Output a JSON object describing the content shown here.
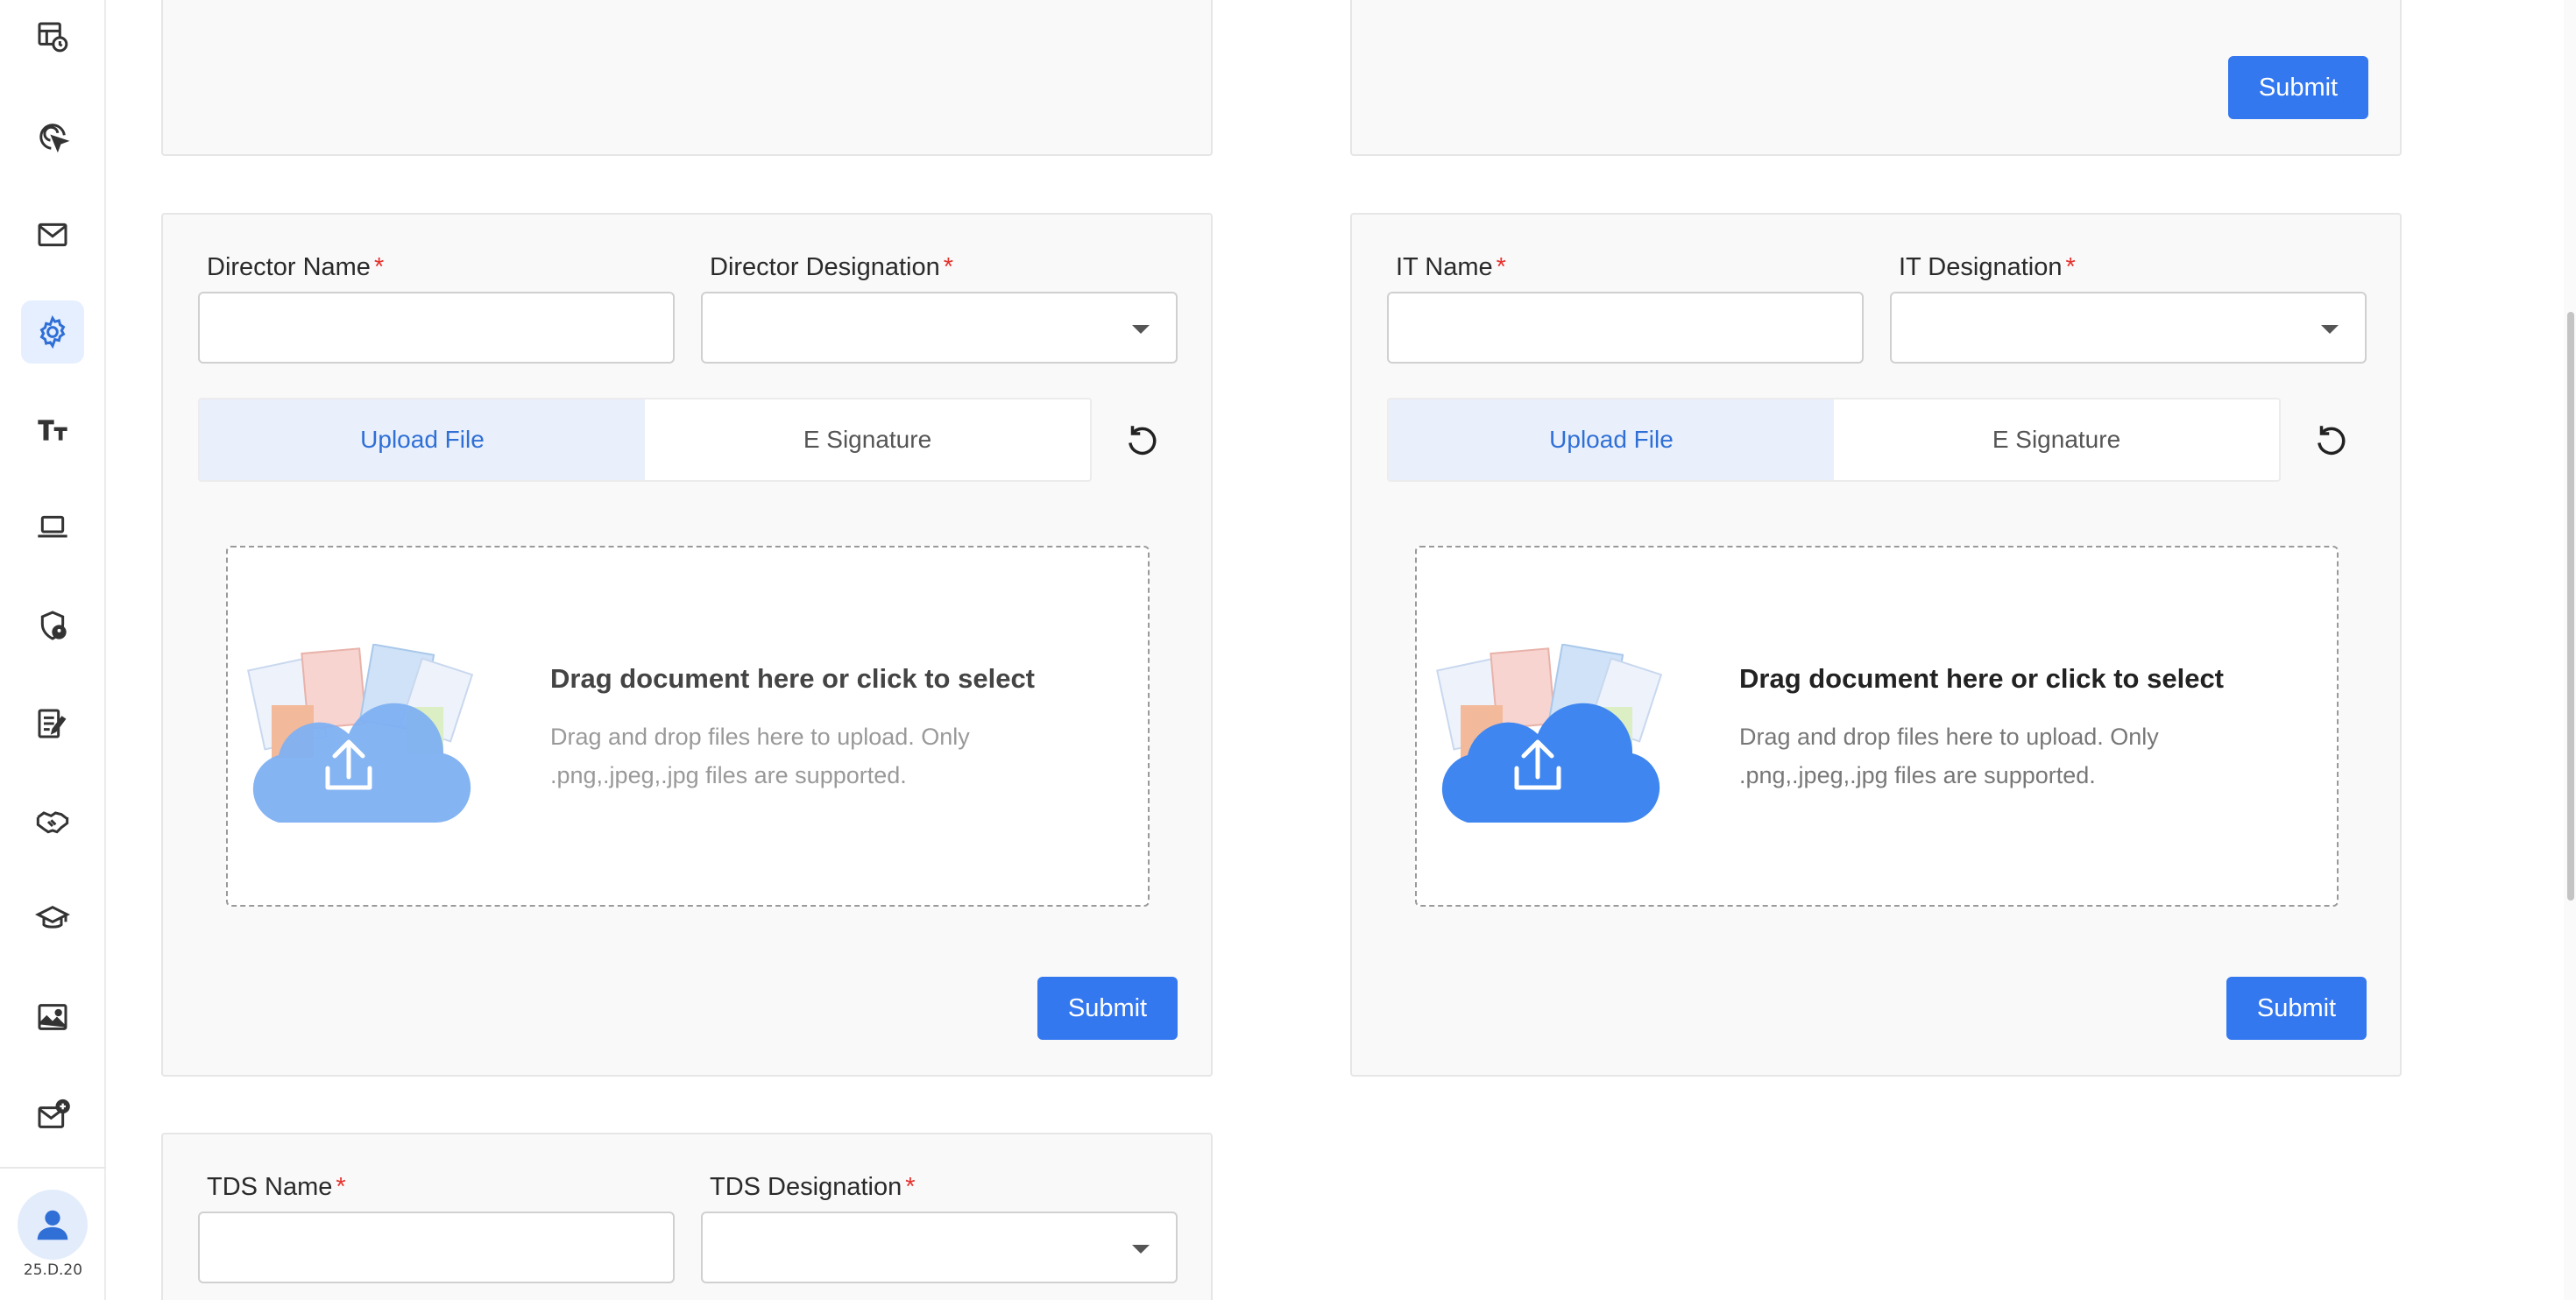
{
  "sidebar": {
    "icons": [
      "dashboard-clock-icon",
      "target-cursor-icon",
      "mail-icon",
      "gear-icon",
      "text-size-icon",
      "laptop-icon",
      "shield-user-icon",
      "edit-document-icon",
      "handshake-icon",
      "graduation-cap-icon",
      "image-icon",
      "mail-badge-icon"
    ],
    "active_icon": "gear-icon",
    "version": "25.D.20"
  },
  "top_right_card": {
    "submit_label": "Submit"
  },
  "director_card": {
    "name_label": "Director Name",
    "designation_label": "Director Designation",
    "required_mark": "*",
    "name_value": "",
    "tabs": [
      {
        "label": "Upload File",
        "active": true
      },
      {
        "label": "E Signature",
        "active": false
      }
    ],
    "dropzone_title": "Drag document here or click to select",
    "dropzone_desc": "Drag and drop files here to upload. Only .png,.jpeg,.jpg files are supported.",
    "submit_label": "Submit"
  },
  "it_card": {
    "name_label": "IT Name",
    "designation_label": "IT Designation",
    "required_mark": "*",
    "name_value": "",
    "tabs": [
      {
        "label": "Upload File",
        "active": true
      },
      {
        "label": "E Signature",
        "active": false
      }
    ],
    "dropzone_title": "Drag document here or click to select",
    "dropzone_desc": "Drag and drop files here to upload. Only .png,.jpeg,.jpg files are supported.",
    "submit_label": "Submit"
  },
  "tds_card": {
    "name_label": "TDS Name",
    "designation_label": "TDS Designation",
    "required_mark": "*",
    "name_value": ""
  },
  "colors": {
    "accent": "#3478f0",
    "required": "#e5322d",
    "active_tab_bg": "#e9f0fb",
    "active_tab_text": "#2f6fd6"
  }
}
